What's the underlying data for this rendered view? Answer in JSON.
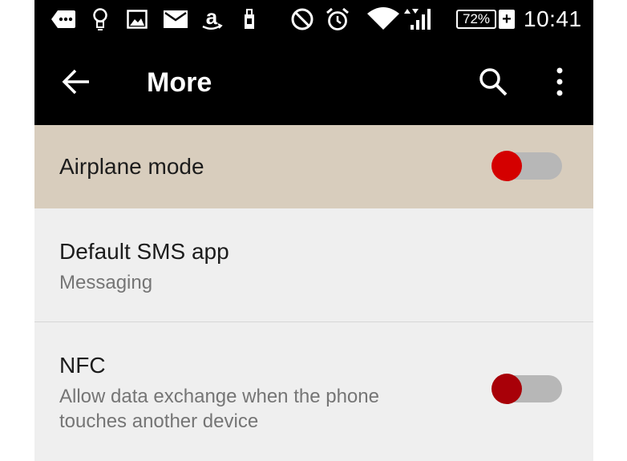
{
  "status_bar": {
    "battery_percent": "72%",
    "battery_charging_symbol": "+",
    "time": "10:41",
    "icons": [
      "message-icon",
      "lightbulb-icon",
      "image-icon",
      "mail-icon",
      "amazon-icon",
      "sd-card-icon",
      "do-not-disturb-icon",
      "alarm-icon",
      "wifi-icon",
      "signal-icon"
    ]
  },
  "toolbar": {
    "title": "More",
    "back_icon": "back-arrow-icon",
    "search_icon": "search-icon",
    "overflow_icon": "more-vert-icon"
  },
  "settings": {
    "airplane": {
      "title": "Airplane mode",
      "enabled": false
    },
    "sms": {
      "title": "Default SMS app",
      "subtitle": "Messaging"
    },
    "nfc": {
      "title": "NFC",
      "subtitle_line1": "Allow data exchange when the phone",
      "subtitle_line2": "touches another device",
      "enabled": false
    }
  },
  "colors": {
    "statusbar_bg": "#000000",
    "toolbar_bg": "#000000",
    "highlight_row": "#d8cdbd",
    "list_bg": "#efefef",
    "toggle_thumb": "#cc0000",
    "toggle_track": "#b7b7b7"
  }
}
